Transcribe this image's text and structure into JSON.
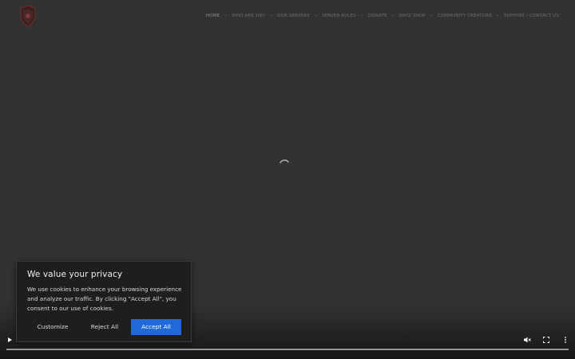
{
  "header": {
    "logo_icon": "shield-logo-icon",
    "nav": [
      {
        "label": "HOME",
        "active": true
      },
      {
        "label": "WHO ARE WE?",
        "active": false
      },
      {
        "label": "OUR SERVERS",
        "active": false
      },
      {
        "label": "SERVER-RULES",
        "active": false
      },
      {
        "label": "DONATE",
        "active": false
      },
      {
        "label": "DAYZ SHOP",
        "active": false
      },
      {
        "label": "COMMUNITY CREATORS",
        "active": false
      },
      {
        "label": "SUPPORT / CONTACT US",
        "active": false
      }
    ],
    "separator": "•"
  },
  "main": {
    "loading_icon": "spinner-icon"
  },
  "video_controls": {
    "play_icon": "play-icon",
    "mute_icon": "muted-volume-icon",
    "fullscreen_icon": "fullscreen-icon",
    "more_icon": "more-vertical-icon"
  },
  "cookie_banner": {
    "title": "We value your privacy",
    "text": "We use cookies to enhance your browsing experience and analyze our traffic. By clicking \"Accept All\", you consent to our use of cookies.",
    "customize_label": "Customize",
    "reject_label": "Reject All",
    "accept_label": "Accept All"
  },
  "colors": {
    "background": "#323232",
    "accent": "#1f6ad8",
    "dialog": "#1e1e1e"
  }
}
